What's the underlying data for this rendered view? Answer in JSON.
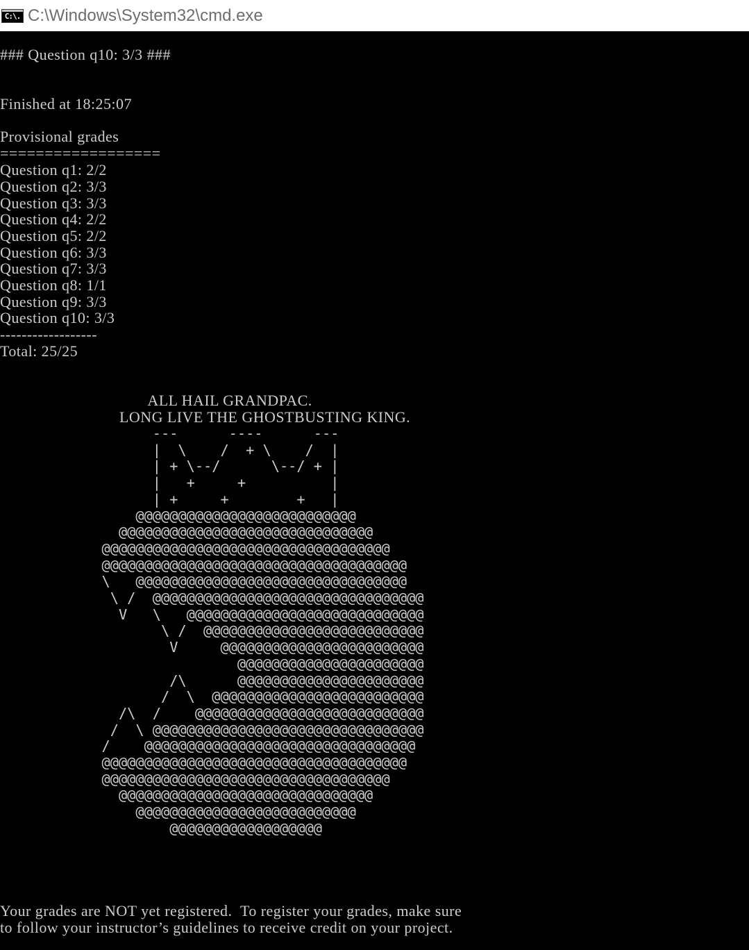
{
  "window": {
    "title": "C:\\Windows\\System32\\cmd.exe",
    "icon": "cmd-icon",
    "icon_text": "C:\\."
  },
  "console": {
    "header": "### Question q10: 3/3 ###",
    "finished": "Finished at 18:25:07",
    "grades_title": "Provisional grades",
    "grades_rule": "==================",
    "grades": [
      "Question q1: 2/2",
      "Question q2: 3/3",
      "Question q3: 3/3",
      "Question q4: 2/2",
      "Question q5: 2/2",
      "Question q6: 3/3",
      "Question q7: 3/3",
      "Question q8: 1/1",
      "Question q9: 3/3",
      "Question q10: 3/3"
    ],
    "total_rule": "------------------",
    "total": "Total: 25/25",
    "hail_line1": "       ALL HAIL GRANDPAC.",
    "hail_line2": "LONG LIVE THE GHOSTBUSTING KING.",
    "ascii_art": [
      "                  ---      ----      ---",
      "                  |  \\    /  + \\    /  |",
      "                  | + \\--/      \\--/ + |",
      "                  |   +     +          |",
      "                  | +     +        +   |",
      "                @@@@@@@@@@@@@@@@@@@@@@@@@@",
      "              @@@@@@@@@@@@@@@@@@@@@@@@@@@@@@",
      "            @@@@@@@@@@@@@@@@@@@@@@@@@@@@@@@@@@",
      "            @@@@@@@@@@@@@@@@@@@@@@@@@@@@@@@@@@@@",
      "            \\   @@@@@@@@@@@@@@@@@@@@@@@@@@@@@@@@",
      "             \\ /  @@@@@@@@@@@@@@@@@@@@@@@@@@@@@@@@",
      "              V   \\   @@@@@@@@@@@@@@@@@@@@@@@@@@@@",
      "                   \\ /  @@@@@@@@@@@@@@@@@@@@@@@@@@",
      "                    V     @@@@@@@@@@@@@@@@@@@@@@@@",
      "                            @@@@@@@@@@@@@@@@@@@@@@",
      "                    /\\      @@@@@@@@@@@@@@@@@@@@@@",
      "                   /  \\  @@@@@@@@@@@@@@@@@@@@@@@@@",
      "              /\\  /    @@@@@@@@@@@@@@@@@@@@@@@@@@@",
      "             /  \\ @@@@@@@@@@@@@@@@@@@@@@@@@@@@@@@@",
      "            /    @@@@@@@@@@@@@@@@@@@@@@@@@@@@@@@@",
      "            @@@@@@@@@@@@@@@@@@@@@@@@@@@@@@@@@@@@",
      "            @@@@@@@@@@@@@@@@@@@@@@@@@@@@@@@@@@",
      "              @@@@@@@@@@@@@@@@@@@@@@@@@@@@@@",
      "                @@@@@@@@@@@@@@@@@@@@@@@@@@",
      "                    @@@@@@@@@@@@@@@@@@"
    ],
    "footer_line1": "Your grades are NOT yet registered.  To register your grades, make sure",
    "footer_line2": "to follow your instructor’s guidelines to receive credit on your project."
  }
}
